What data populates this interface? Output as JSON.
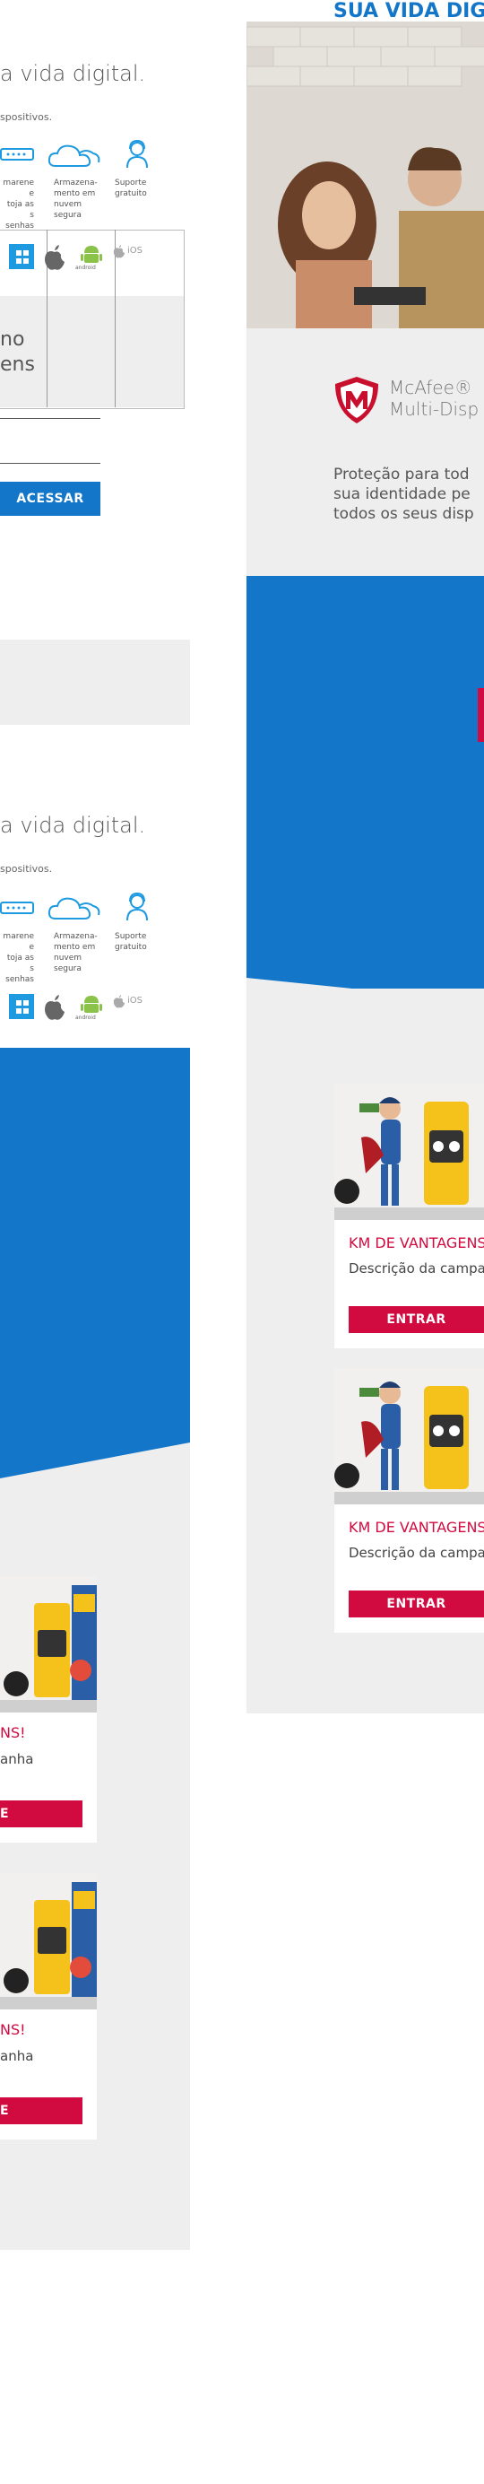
{
  "section1": {
    "heading": "a vida digital.",
    "subline": "spositivos.",
    "features": [
      {
        "icon": "password-icon",
        "label": "marene e\ntoja as\ns senhas"
      },
      {
        "icon": "cloud-icon",
        "label": "Armazena-\nmento em\nnuvem\nsegura"
      },
      {
        "icon": "support-person-icon",
        "label": "Suporte\ngratuito"
      }
    ],
    "os": [
      "windows-icon",
      "apple-icon",
      "android-icon",
      "ios-icon"
    ],
    "os_android_label": "android",
    "os_ios_label": "iOS",
    "box_text_line1": "no",
    "box_text_line2": "ens",
    "access_button": "ACESSAR"
  },
  "section2": {
    "heading": "a vida digital.",
    "subline": "spositivos.",
    "features": [
      {
        "icon": "password-icon",
        "label": "marene e\ntoja as\ns senhas"
      },
      {
        "icon": "cloud-icon",
        "label": "Armazena-\nmento em\nnuvem\nsegura"
      },
      {
        "icon": "support-person-icon",
        "label": "Suporte\ngratuito"
      }
    ],
    "os_android_label": "android",
    "os_ios_label": "iOS"
  },
  "left_cards": [
    {
      "title": "NS!",
      "desc": "anha",
      "button": "E"
    },
    {
      "title": "NS!",
      "desc": "anha",
      "button": "E"
    }
  ],
  "right": {
    "top_heading": "SUA VIDA DIG",
    "mcafee_brand": "McAfee®",
    "mcafee_product": "Multi-Disp",
    "desc_lines": [
      "Proteção para tod",
      "sua identidade pe",
      "todos os seus disp"
    ],
    "cards": [
      {
        "title": "KM DE VANTAGENS",
        "desc": "Descrição da campan",
        "button": "ENTRAR"
      },
      {
        "title": "KM DE VANTAGENS",
        "desc": "Descrição da campan",
        "button": "ENTRAR"
      }
    ]
  },
  "colors": {
    "blue": "#1376c8",
    "red": "#d10a3f",
    "grey": "#efeeee"
  }
}
